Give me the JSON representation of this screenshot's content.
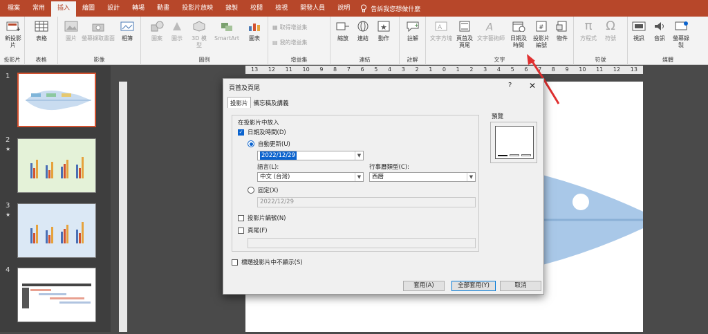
{
  "tabs": [
    "檔案",
    "常用",
    "插入",
    "繪圖",
    "設計",
    "轉場",
    "動畫",
    "投影片放映",
    "錄製",
    "校閱",
    "檢視",
    "開發人員",
    "說明"
  ],
  "tell_me": "告訴我您想做什麼",
  "ribbon": {
    "new_slide": "新投影片",
    "table": "表格",
    "pictures": "圖片",
    "screenshot": "螢幕擷取畫面",
    "album": "相簿",
    "shapes": "圖案",
    "icons": "圖示",
    "models3d": "3D 模型",
    "smartart": "SmartArt",
    "chart": "圖表",
    "get_addins": "取得增益集",
    "my_addins": "我的增益集",
    "zoom": "縮放",
    "link": "連結",
    "action": "動作",
    "comment": "註解",
    "textbox": "文字方塊",
    "header_footer": "頁首及頁尾",
    "wordart": "文字藝術師",
    "date_time": "日期及時間",
    "slide_number": "投影片編號",
    "object": "物件",
    "equation": "方程式",
    "symbol": "符號",
    "video": "視訊",
    "audio": "音訊",
    "screen_recording": "螢幕錄製",
    "groups": {
      "slides": "投影片",
      "tables": "表格",
      "images": "影像",
      "illustrations": "圖例",
      "addins": "增益集",
      "links": "連結",
      "comments": "註解",
      "text": "文字",
      "symbols": "符號",
      "media": "媒體"
    }
  },
  "ruler": [
    "13",
    "12",
    "11",
    "10",
    "9",
    "8",
    "7",
    "6",
    "5",
    "4",
    "3",
    "2",
    "1",
    "0",
    "1",
    "2",
    "3",
    "4",
    "5",
    "6",
    "7",
    "8",
    "9",
    "10",
    "11",
    "12",
    "13"
  ],
  "slides": [
    {
      "num": "1",
      "star": ""
    },
    {
      "num": "2",
      "star": "★"
    },
    {
      "num": "3",
      "star": "★"
    },
    {
      "num": "4",
      "star": ""
    }
  ],
  "dialog": {
    "title": "頁首及頁尾",
    "help": "?",
    "close": "✕",
    "tab_slide": "投影片",
    "tab_notes": "備忘稿及講義",
    "include_label": "在投影片中放入",
    "date_time": "日期及時間(D)",
    "auto_update": "自動更新(U)",
    "date_value": "2022/12/29",
    "language_label": "語言(L):",
    "language_value": "中文 (台灣)",
    "calendar_label": "行事曆類型(C):",
    "calendar_value": "西曆",
    "fixed": "固定(X)",
    "fixed_value": "2022/12/29",
    "slide_number": "投影片編號(N)",
    "footer": "頁尾(F)",
    "dont_show": "標題投影片中不顯示(S)",
    "preview": "預覽",
    "apply": "套用(A)",
    "apply_all": "全部套用(Y)",
    "cancel": "取消"
  },
  "colors": {
    "accent": "#b7472a",
    "arrow": "#e03030",
    "fish": "#a9c8e8",
    "highlight": "#0b63ce"
  }
}
